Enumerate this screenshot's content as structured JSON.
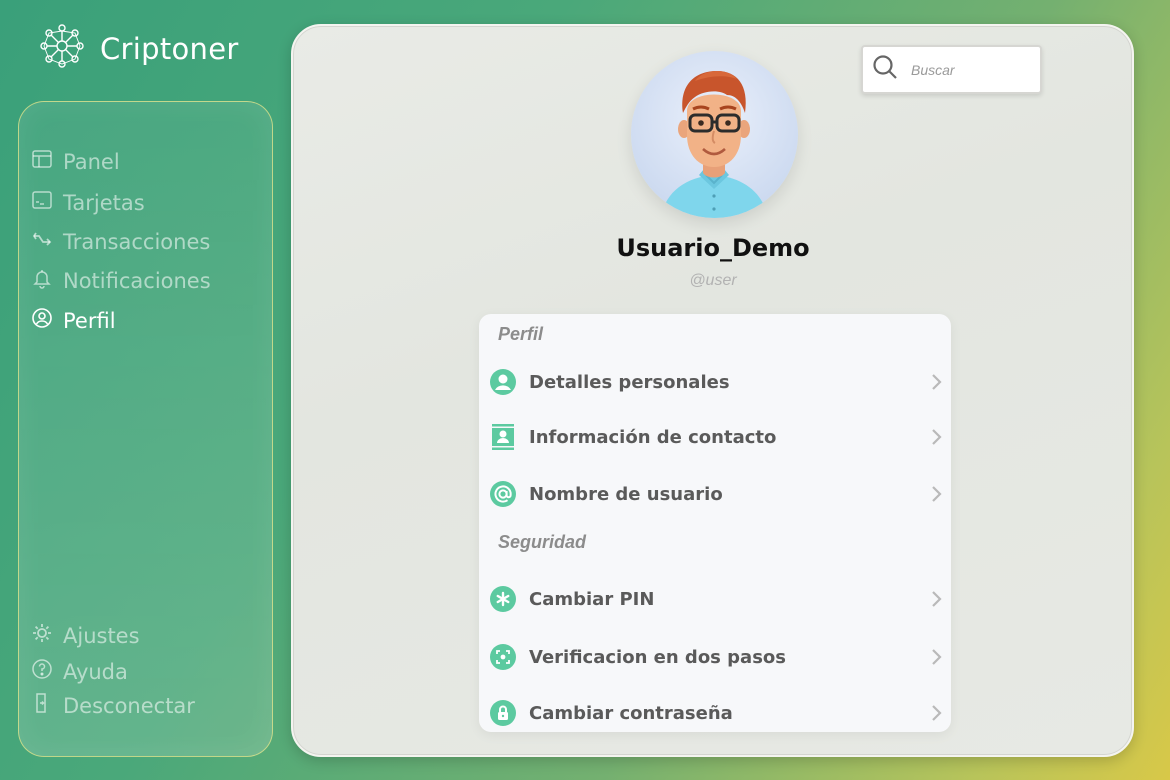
{
  "brand": {
    "name": "Criptoner"
  },
  "sidebar": {
    "items": [
      {
        "label": "Panel",
        "icon": "layout-icon"
      },
      {
        "label": "Tarjetas",
        "icon": "card-icon"
      },
      {
        "label": "Transacciones",
        "icon": "transfer-icon"
      },
      {
        "label": "Notificaciones",
        "icon": "bell-icon"
      },
      {
        "label": "Perfil",
        "icon": "user-circle-icon",
        "active": true
      }
    ],
    "bottom_items": [
      {
        "label": "Ajustes",
        "icon": "gear-icon"
      },
      {
        "label": "Ayuda",
        "icon": "help-icon"
      },
      {
        "label": "Desconectar",
        "icon": "logout-icon"
      }
    ]
  },
  "search": {
    "placeholder": "Buscar"
  },
  "profile": {
    "username": "Usuario_Demo",
    "handle": "@user"
  },
  "sections": {
    "perfil": {
      "title": "Perfil",
      "items": [
        {
          "label": "Detalles personales",
          "icon": "person-icon"
        },
        {
          "label": "Información de contacto",
          "icon": "contact-card-icon"
        },
        {
          "label": "Nombre de usuario",
          "icon": "at-sign-icon"
        }
      ]
    },
    "seguridad": {
      "title": "Seguridad",
      "items": [
        {
          "label": "Cambiar PIN",
          "icon": "asterisk-icon"
        },
        {
          "label": "Verificacion en dos pasos",
          "icon": "scan-icon"
        },
        {
          "label": "Cambiar contraseña",
          "icon": "lock-icon"
        }
      ]
    }
  },
  "colors": {
    "accent": "#5ccaa0",
    "background_start": "#3aa07a",
    "background_end": "#d8c848"
  }
}
